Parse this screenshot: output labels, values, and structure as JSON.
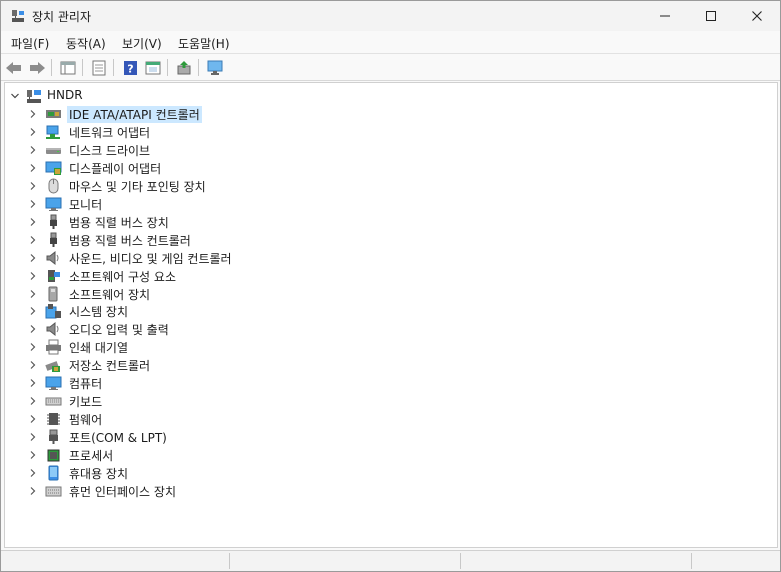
{
  "window": {
    "title": "장치 관리자",
    "controls": {
      "minimize": "minimize-icon",
      "maximize": "maximize-icon",
      "close": "close-icon"
    }
  },
  "menu": [
    {
      "label": "파일(F)"
    },
    {
      "label": "동작(A)"
    },
    {
      "label": "보기(V)"
    },
    {
      "label": "도움말(H)"
    }
  ],
  "toolbar": {
    "buttons": [
      "back-icon",
      "forward-icon",
      "properties-icon",
      "grid-icon",
      "help-icon",
      "view-icon",
      "update-driver-icon",
      "monitor-scan-icon"
    ]
  },
  "tree": {
    "root": "HNDR",
    "selected_index": 0,
    "items": [
      {
        "label": "IDE ATA/ATAPI 컨트롤러",
        "icon": "ide-controller-icon"
      },
      {
        "label": "네트워크 어댑터",
        "icon": "network-adapter-icon"
      },
      {
        "label": "디스크 드라이브",
        "icon": "disk-drive-icon"
      },
      {
        "label": "디스플레이 어댑터",
        "icon": "display-adapter-icon"
      },
      {
        "label": "마우스 및 기타 포인팅 장치",
        "icon": "mouse-icon"
      },
      {
        "label": "모니터",
        "icon": "monitor-icon"
      },
      {
        "label": "범용 직렬 버스 장치",
        "icon": "usb-icon"
      },
      {
        "label": "범용 직렬 버스 컨트롤러",
        "icon": "usb-icon"
      },
      {
        "label": "사운드, 비디오 및 게임 컨트롤러",
        "icon": "speaker-icon"
      },
      {
        "label": "소프트웨어 구성 요소",
        "icon": "software-component-icon"
      },
      {
        "label": "소프트웨어 장치",
        "icon": "software-device-icon"
      },
      {
        "label": "시스템 장치",
        "icon": "system-device-icon"
      },
      {
        "label": "오디오 입력 및 출력",
        "icon": "speaker-icon"
      },
      {
        "label": "인쇄 대기열",
        "icon": "printer-icon"
      },
      {
        "label": "저장소 컨트롤러",
        "icon": "storage-controller-icon"
      },
      {
        "label": "컴퓨터",
        "icon": "computer-icon"
      },
      {
        "label": "키보드",
        "icon": "keyboard-icon"
      },
      {
        "label": "펌웨어",
        "icon": "firmware-icon"
      },
      {
        "label": "포트(COM & LPT)",
        "icon": "port-icon"
      },
      {
        "label": "프로세서",
        "icon": "processor-icon"
      },
      {
        "label": "휴대용 장치",
        "icon": "portable-device-icon"
      },
      {
        "label": "휴먼 인터페이스 장치",
        "icon": "hid-icon"
      }
    ]
  },
  "colors": {
    "selection": "#cce8ff",
    "accent_blue": "#2a7fd4"
  }
}
